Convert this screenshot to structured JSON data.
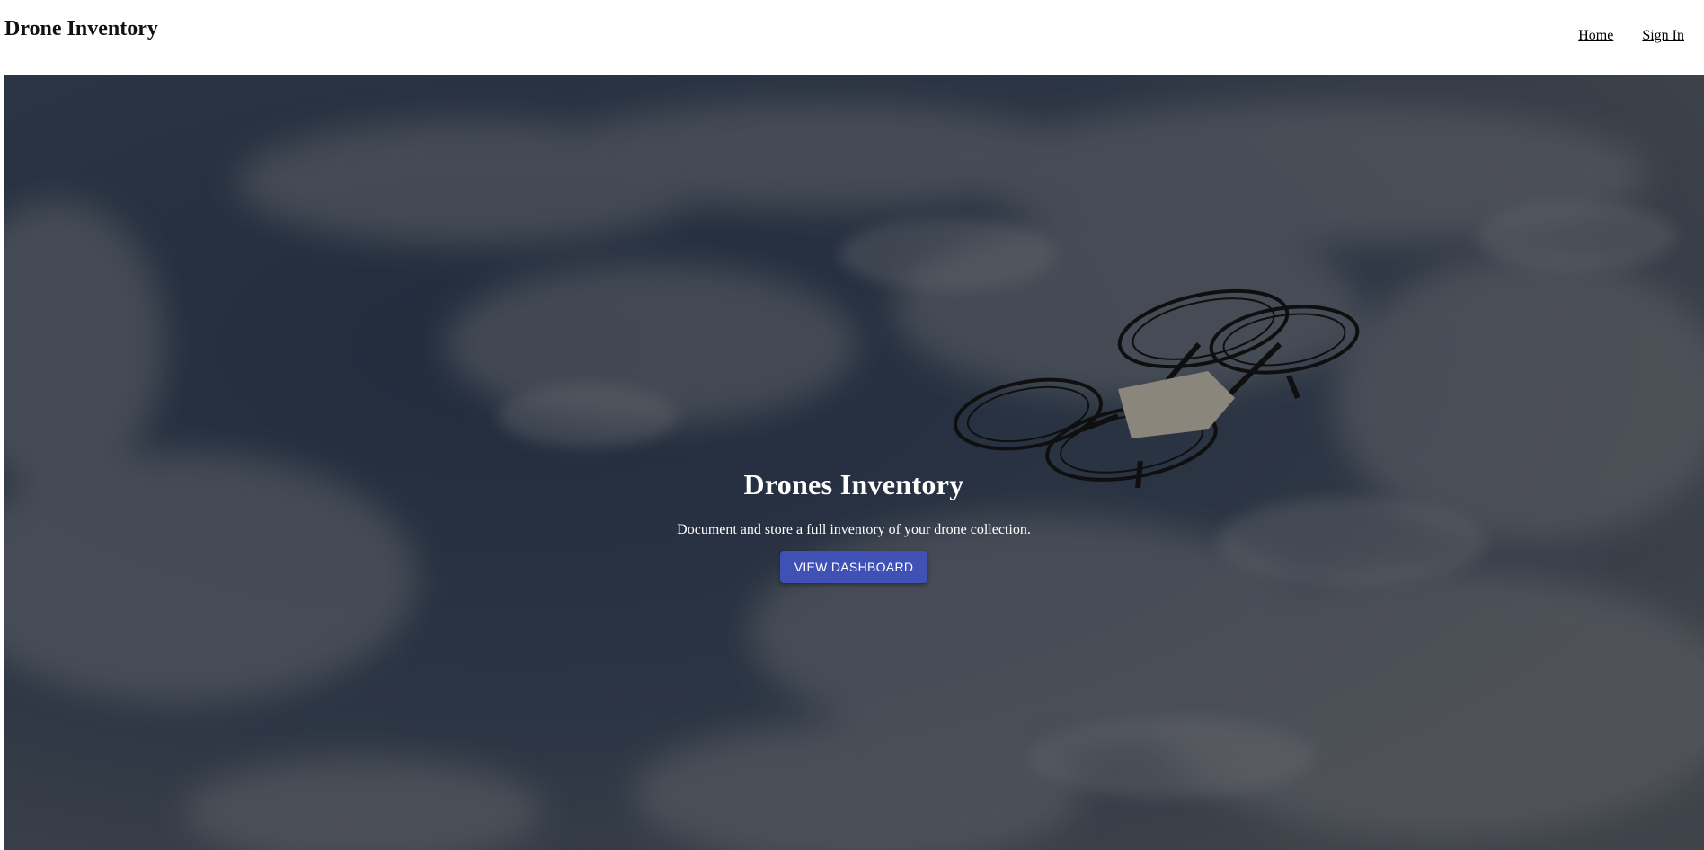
{
  "header": {
    "brand": "Drone Inventory",
    "nav": [
      {
        "label": "Home"
      },
      {
        "label": "Sign In"
      }
    ]
  },
  "hero": {
    "title": "Drones Inventory",
    "subtitle": "Document and store a full inventory of your drone collection.",
    "cta_label": "VIEW DASHBOARD",
    "background": "drone-in-cloudy-sky-image"
  },
  "colors": {
    "accent": "#3f51b5",
    "sky": "#3c4a60",
    "text_light": "#ffffff"
  }
}
